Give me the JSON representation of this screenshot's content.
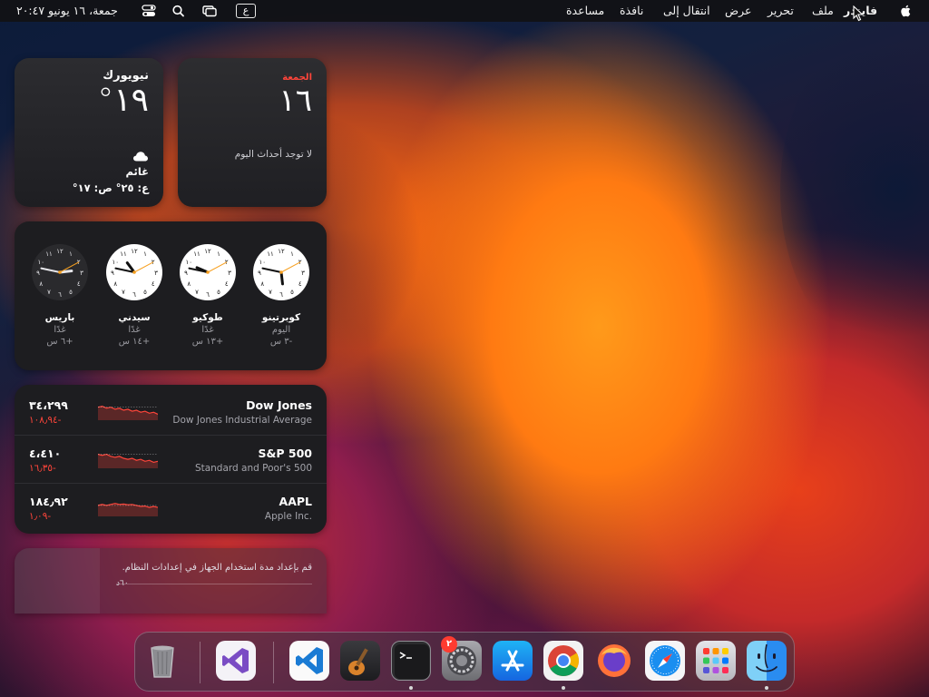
{
  "menubar": {
    "app_name": "فايندر",
    "menus": [
      "ملف",
      "تحرير",
      "عرض",
      "انتقال إلى",
      "نافذة",
      "مساعدة"
    ],
    "clock": "جمعة، ١٦ يونيو ٢٠:٤٧",
    "input_source": "ع",
    "icons": [
      "apple-logo",
      "control-center",
      "spotlight",
      "screen-mirroring"
    ]
  },
  "calendar": {
    "day_name": "الجمعة",
    "date": "١٦",
    "no_events": "لا توجد أحداث اليوم"
  },
  "weather": {
    "city": "نيويورك",
    "temperature": "١٩°",
    "condition": "غائم",
    "range": "ع: ٢٥° ص: ١٧°",
    "icon": "cloud"
  },
  "clocks": [
    {
      "city": "كوبرتينو",
      "day": "اليوم",
      "offset": "-٣ س",
      "hour": 5,
      "minute": 47,
      "dark": false
    },
    {
      "city": "طوكيو",
      "day": "غدًا",
      "offset": "+١٣ س",
      "hour": 9,
      "minute": 47,
      "dark": false
    },
    {
      "city": "سيدني",
      "day": "غدًا",
      "offset": "+١٤ س",
      "hour": 10,
      "minute": 47,
      "dark": false
    },
    {
      "city": "باريس",
      "day": "غدًا",
      "offset": "+٦ س",
      "hour": 2,
      "minute": 47,
      "dark": true
    }
  ],
  "clock_numerals": [
    "١٢",
    "١",
    "٢",
    "٣",
    "٤",
    "٥",
    "٦",
    "٧",
    "٨",
    "٩",
    "١٠",
    "١١"
  ],
  "stocks": [
    {
      "symbol": "Dow Jones",
      "name": "Dow Jones Industrial Average",
      "price": "٣٤،٢٩٩",
      "change": "-١٠٨٫٩٤",
      "trend": [
        0.35,
        0.3,
        0.4,
        0.35,
        0.45,
        0.4,
        0.5,
        0.45,
        0.55,
        0.5,
        0.6,
        0.55,
        0.65,
        0.6,
        0.7
      ]
    },
    {
      "symbol": "S&P 500",
      "name": "Standard and Poor's 500",
      "price": "٤،٤١٠",
      "change": "-١٦٫٣٥",
      "trend": [
        0.3,
        0.35,
        0.3,
        0.4,
        0.45,
        0.4,
        0.5,
        0.55,
        0.5,
        0.6,
        0.55,
        0.65,
        0.6,
        0.7,
        0.65
      ]
    },
    {
      "symbol": "AAPL",
      "name": "Apple Inc.",
      "price": "١٨٤٫٩٢",
      "change": "-١٫٠٩",
      "trend": [
        0.45,
        0.4,
        0.45,
        0.4,
        0.35,
        0.4,
        0.38,
        0.42,
        0.4,
        0.45,
        0.5,
        0.48,
        0.55,
        0.5,
        0.55
      ]
    }
  ],
  "screen_time": {
    "message": "قم بإعداد مدة استخدام الجهاز في إعدادات النظام.",
    "axis_label": "٦٠د"
  },
  "dock": {
    "apps": [
      "finder",
      "launchpad",
      "safari",
      "firefox",
      "chrome",
      "app-store",
      "system-settings",
      "terminal",
      "garageband",
      "vscode",
      "visual-studio",
      "trash"
    ],
    "system_settings_badge": "٢"
  },
  "colors": {
    "accent_red": "#ff453a",
    "clock_hand_orange": "#f7a020"
  }
}
